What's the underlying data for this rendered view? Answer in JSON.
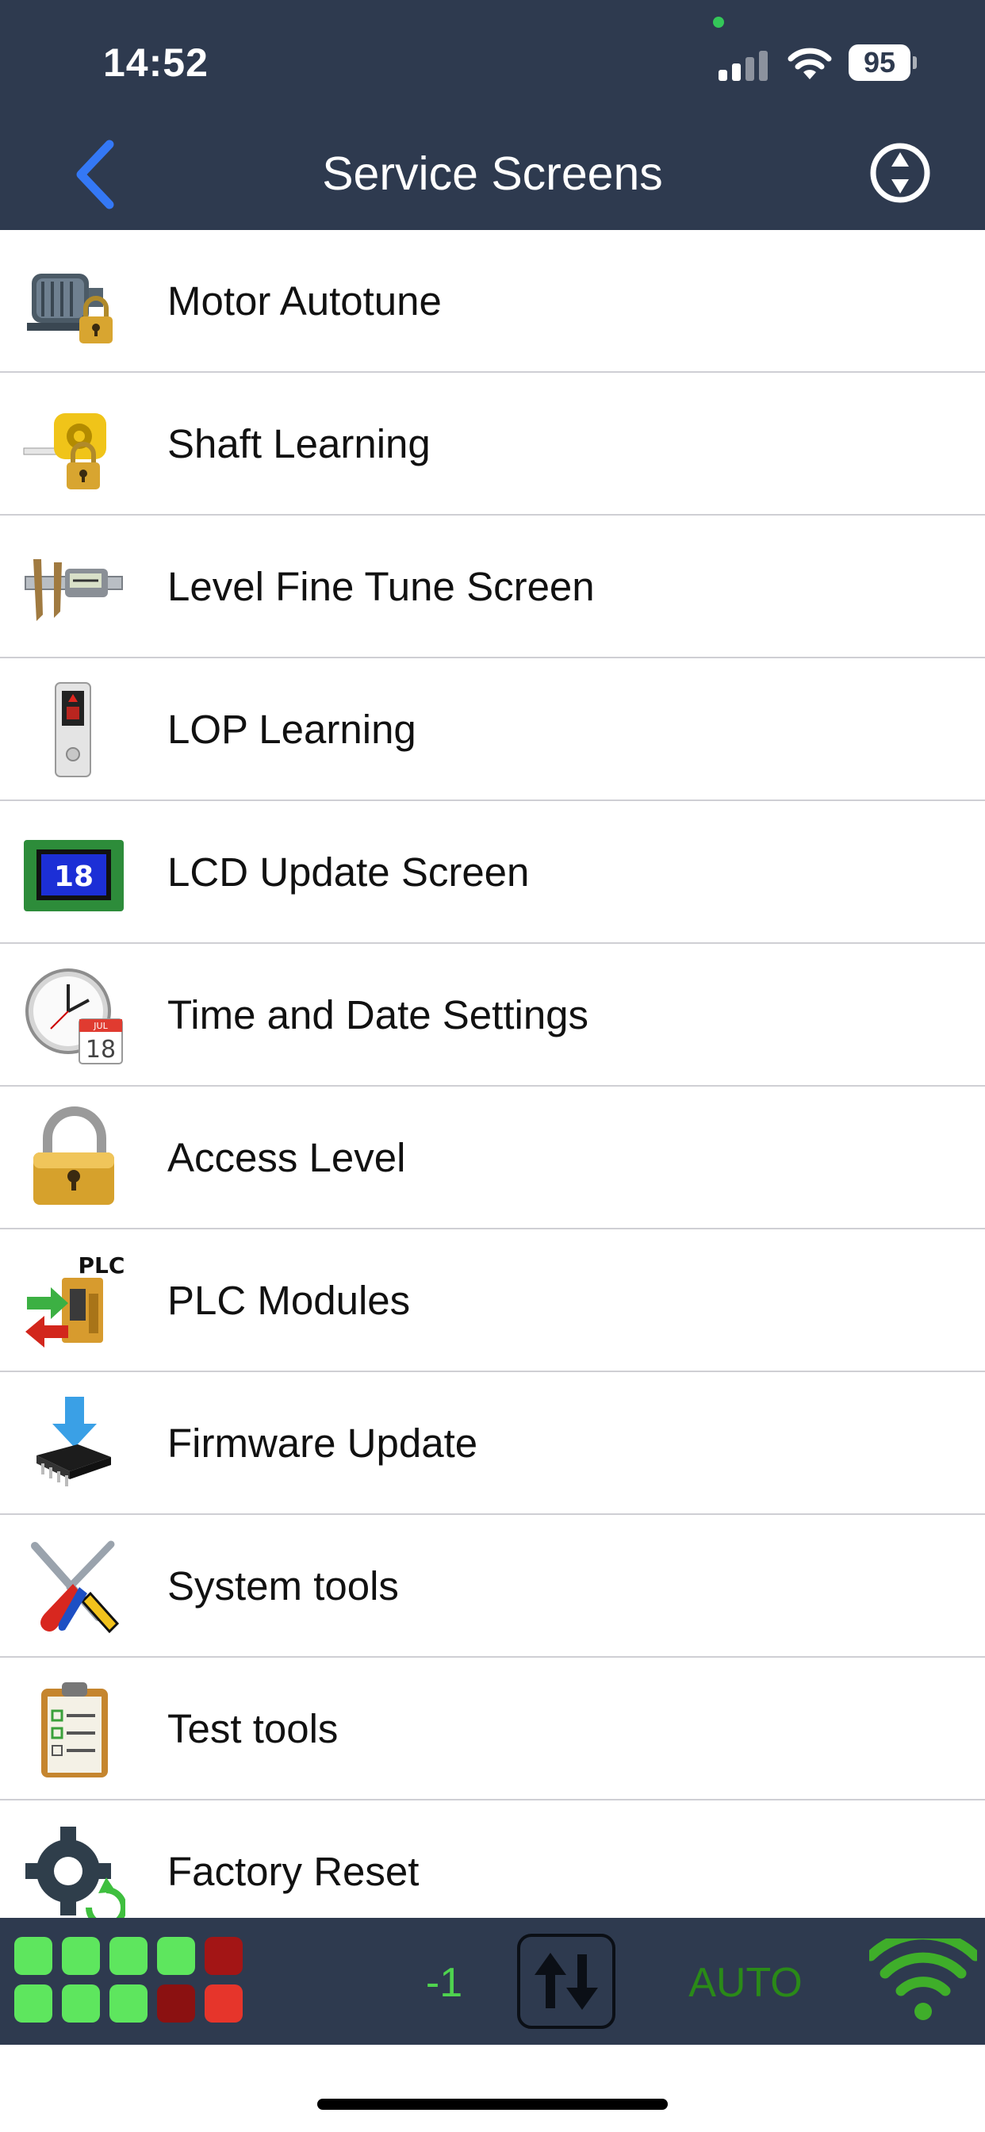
{
  "status_bar": {
    "time": "14:52",
    "battery": "95"
  },
  "nav": {
    "title": "Service Screens",
    "back_icon": "chevron-left",
    "sort_icon": "up-down-circle"
  },
  "menu": {
    "items": [
      {
        "label": "Motor Autotune",
        "icon": "motor-lock-icon"
      },
      {
        "label": "Shaft Learning",
        "icon": "tape-measure-lock-icon"
      },
      {
        "label": "Level Fine Tune Screen",
        "icon": "caliper-icon"
      },
      {
        "label": "LOP Learning",
        "icon": "landing-panel-icon"
      },
      {
        "label": "LCD Update Screen",
        "icon": "lcd-display-icon"
      },
      {
        "label": "Time and Date Settings",
        "icon": "clock-calendar-icon"
      },
      {
        "label": "Access Level",
        "icon": "padlock-icon"
      },
      {
        "label": "PLC Modules",
        "icon": "plc-module-icon"
      },
      {
        "label": "Firmware Update",
        "icon": "chip-download-icon"
      },
      {
        "label": "System tools",
        "icon": "tools-icon"
      },
      {
        "label": "Test tools",
        "icon": "clipboard-checklist-icon"
      },
      {
        "label": "Factory Reset",
        "icon": "gear-reset-icon"
      }
    ],
    "lcd_icon_text": "18",
    "calendar_icon_text": "18",
    "calendar_icon_month": "JUL",
    "plc_icon_text": "PLC"
  },
  "bottom_bar": {
    "floor": "-1",
    "mode": "AUTO",
    "led_colors": [
      "#5ee65e",
      "#5ee65e",
      "#5ee65e",
      "#5ee65e",
      "#a31515",
      "#5ee65e",
      "#5ee65e",
      "#5ee65e",
      "#8b1111",
      "#e6352b"
    ]
  },
  "colors": {
    "bar_background": "#2e3a4f",
    "accent_blue": "#3478f6",
    "floor_green": "#4fd44f",
    "auto_green": "#2a8a18"
  }
}
